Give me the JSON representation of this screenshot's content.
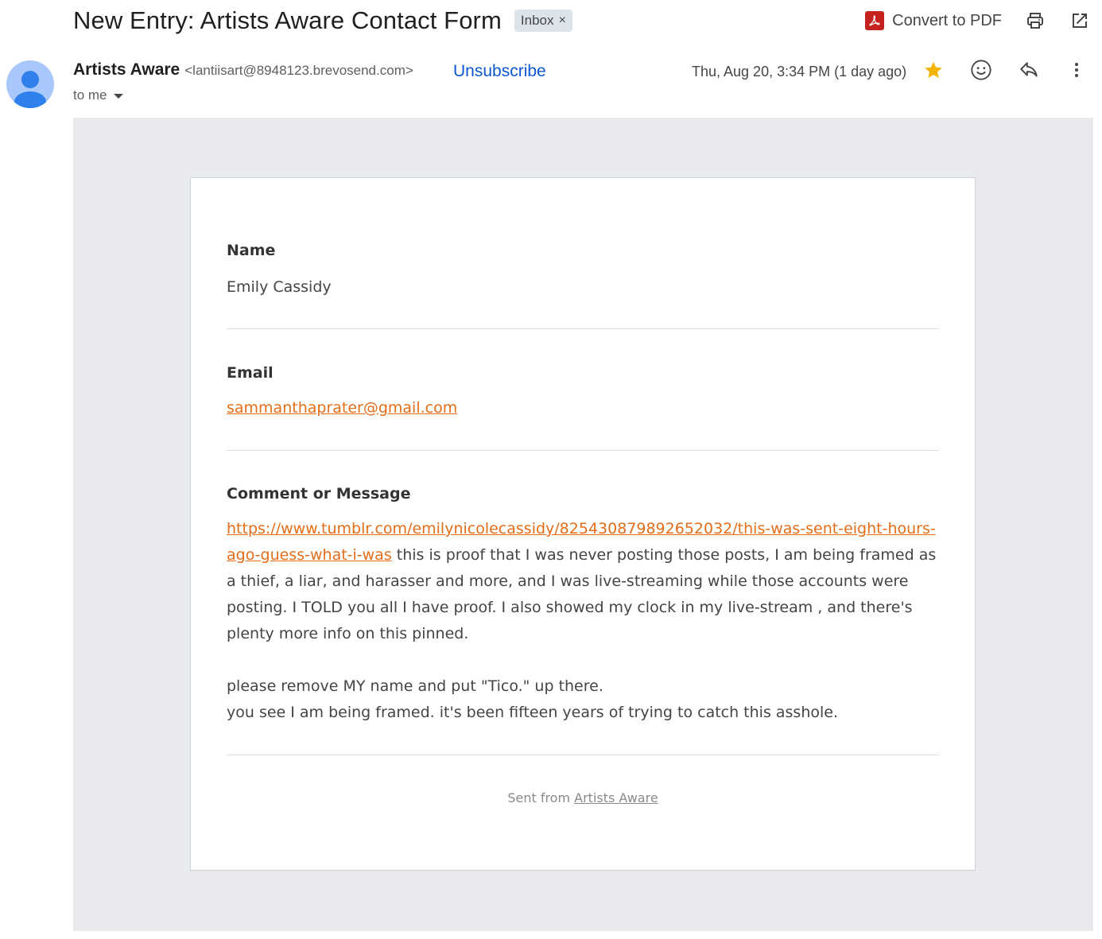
{
  "subject": {
    "title": "New Entry: Artists Aware Contact Form",
    "label": "Inbox",
    "label_remove": "×"
  },
  "toolbar": {
    "convert_pdf_label": "Convert to PDF",
    "icons": [
      "pdf-icon",
      "print-icon",
      "open-in-new-window-icon"
    ]
  },
  "sender": {
    "name": "Artists Aware",
    "email": "<lantiisart@8948123.brevosend.com>",
    "unsubscribe": "Unsubscribe",
    "recipient": "to me",
    "date": "Thu, Aug 20, 3:34 PM (1 day ago)",
    "icons": [
      "star-icon",
      "emoji-icon",
      "reply-icon",
      "more-vert-icon"
    ],
    "star_color": "#f4b400"
  },
  "form": {
    "fields": [
      {
        "label": "Name",
        "value": "Emily Cassidy"
      },
      {
        "label": "Email",
        "value": "sammanthaprater@gmail.com"
      },
      {
        "label": "Comment or Message"
      }
    ],
    "message": {
      "link": "https://www.tumblr.com/emilynicolecassidy/825430879892652032/this-was-sent-eight-hours-ago-guess-what-i-was",
      "text_after_link": " this is proof that I was never posting those posts, I am being framed as a thief, a liar, and harasser and more, and I was live-streaming while those accounts were posting. I TOLD you all I have proof. I also showed my clock in my live-stream , and there's plenty more info on this pinned.",
      "line2": "please remove MY name and put \"Tico.\" up there.",
      "line3": "you see I am being framed. it's been fifteen years of trying to catch this asshole."
    },
    "footer_prefix": "Sent from ",
    "footer_link": "Artists Aware"
  },
  "colors": {
    "link_orange": "#e36d19",
    "unsubscribe_blue": "#0b57d0",
    "body_background": "#e8eaed"
  }
}
